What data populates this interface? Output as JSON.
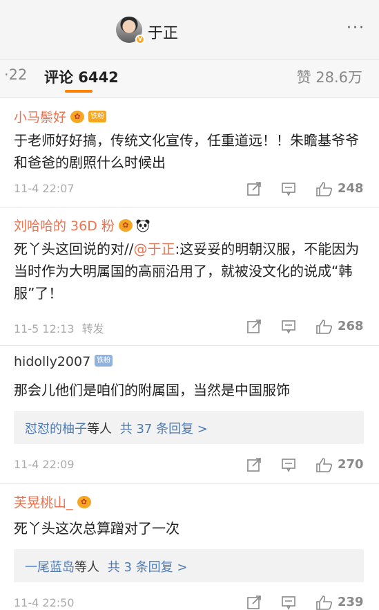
{
  "header": {
    "user_name": "于正",
    "more_label": "···"
  },
  "tabs": {
    "reposts_partial": "·22",
    "comments_label": "评论 6442",
    "likes_label": "赞 28.6万"
  },
  "comments": [
    {
      "author": "小马鬃好",
      "badge": "铁粉",
      "text": "于老师好好搞，传统文化宣传，任重道远！！朱瞻基爷爷和爸爸的剧照什么时候出",
      "time": "11-4 22:07",
      "likes": "248"
    },
    {
      "author": "刘哈哈的 36D 粉",
      "text_before": "死丫头这回说的对//",
      "mention": "@于正",
      "text_after": ":这妥妥的明朝汉服，不能因为当时作为大明属国的高丽沿用了，就被没文化的说成“韩服”了！",
      "time": "11-5 12:13",
      "repost_label": "转发",
      "likes": "268"
    },
    {
      "author": "hidolly2007",
      "badge": "铁粉",
      "text": "那会儿他们是咱们的附属国，当然是中国服饰",
      "reply_user": "怼怼的柚子",
      "reply_mid": "等人",
      "reply_count": "共 37 条回复 >",
      "time": "11-4 22:09",
      "likes": "270"
    },
    {
      "author": "芙晃桃山_",
      "text": "死丫头这次总算蹭对了一次",
      "reply_user": "一尾蓝岛",
      "reply_mid": "等人",
      "reply_count": "共 3 条回复 >",
      "time": "11-4 22:50",
      "likes": "239"
    }
  ],
  "colors": {
    "accent_orange": "#ff8200",
    "author_orange": "#eb7350",
    "link_blue": "#4d7ab3"
  },
  "icons": [
    "avatar",
    "vip-badge-icon",
    "repost-icon",
    "comment-icon",
    "like-icon",
    "panda-icon"
  ]
}
